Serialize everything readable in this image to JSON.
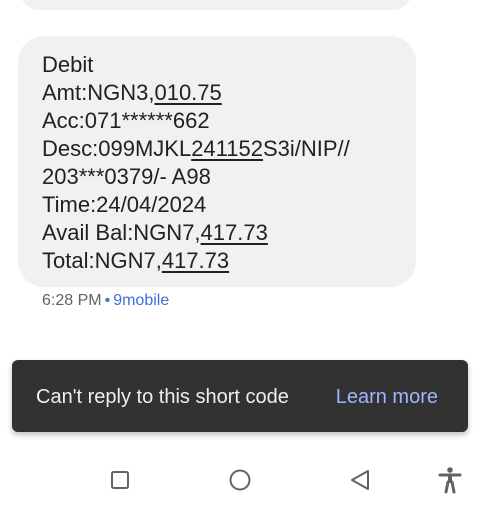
{
  "message": {
    "lines": [
      {
        "parts": [
          {
            "text": "Debit",
            "u": false
          }
        ]
      },
      {
        "parts": [
          {
            "text": "Amt:NGN3,",
            "u": false
          },
          {
            "text": "010.75",
            "u": true
          }
        ]
      },
      {
        "parts": [
          {
            "text": "Acc:071******662",
            "u": false
          }
        ]
      },
      {
        "parts": [
          {
            "text": "Desc:099MJKL",
            "u": false
          },
          {
            "text": "241152",
            "u": true
          },
          {
            "text": "S3i/NIP//",
            "u": false
          }
        ]
      },
      {
        "parts": [
          {
            "text": "203***0379/- A98",
            "u": false
          }
        ]
      },
      {
        "parts": [
          {
            "text": "Time:24/04/2024",
            "u": false
          }
        ]
      },
      {
        "parts": [
          {
            "text": "Avail Bal:NGN7,",
            "u": false
          },
          {
            "text": "417.73",
            "u": true
          }
        ]
      },
      {
        "parts": [
          {
            "text": "Total:NGN7,",
            "u": false
          },
          {
            "text": "417.73",
            "u": true
          }
        ]
      }
    ],
    "time": "6:28 PM",
    "separator": "•",
    "carrier": "9mobile"
  },
  "snackbar": {
    "text": "Can't reply to this short code",
    "action": "Learn more"
  },
  "navbar": {
    "buttons": [
      "recents-square-icon",
      "home-circle-icon",
      "back-triangle-icon",
      "accessibility-icon"
    ]
  },
  "colors": {
    "bubble": "#f1f1f1",
    "link": "#3c6fd8",
    "snackbar_bg": "#323232",
    "snackbar_action": "#9db6ff",
    "nav_icon": "#5f6368"
  }
}
